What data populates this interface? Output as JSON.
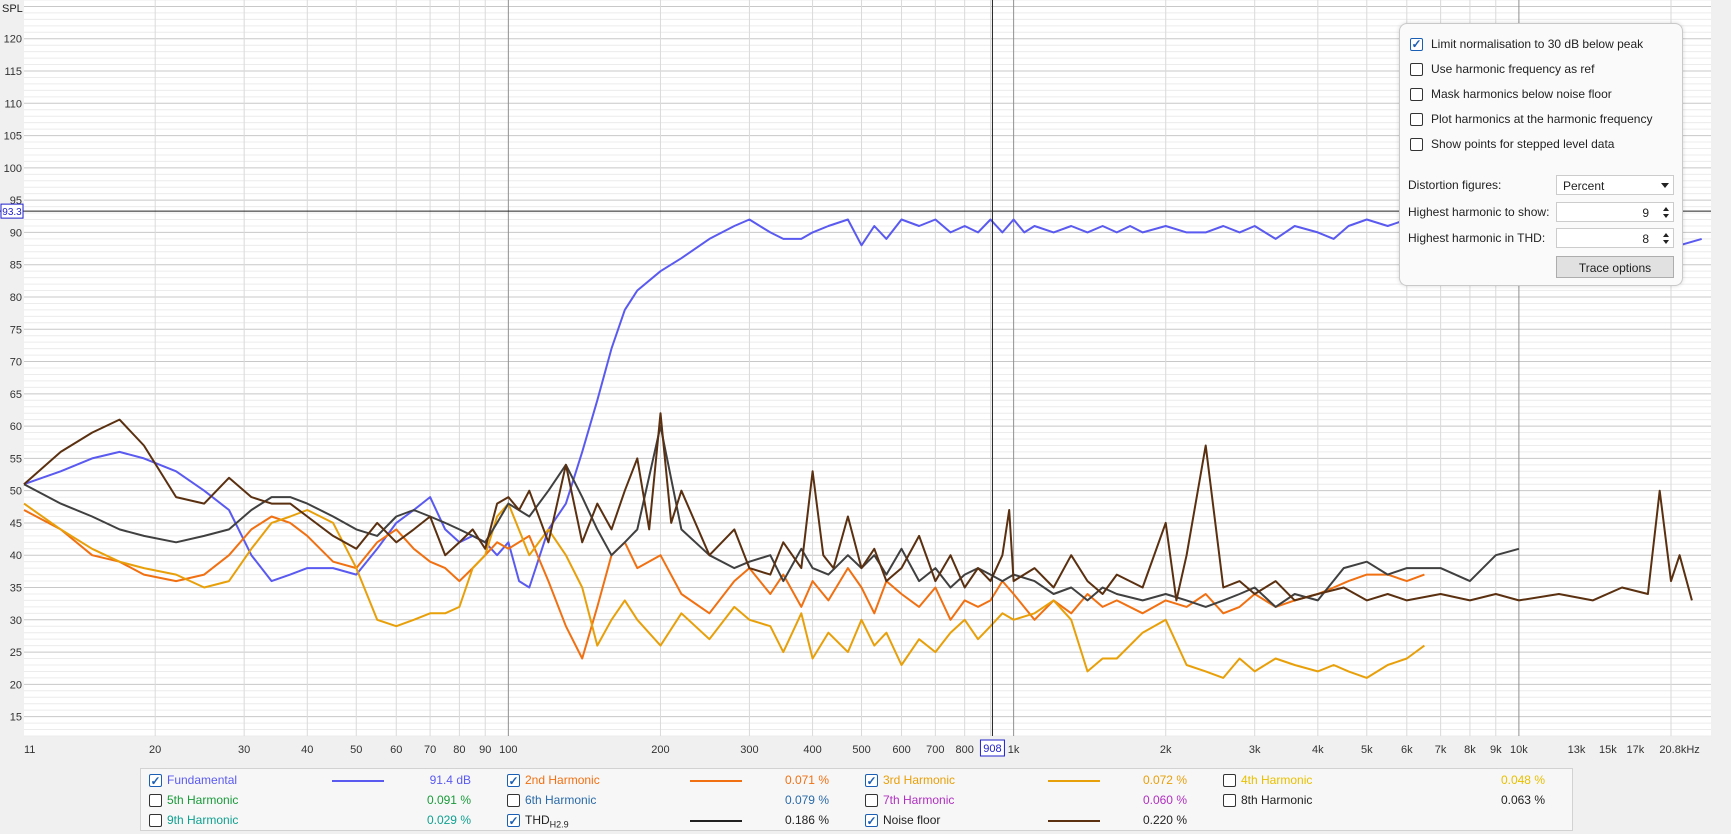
{
  "chart_data": {
    "type": "line",
    "ylabel": "SPL",
    "x_scale": "log",
    "xlim": [
      11,
      24000
    ],
    "ylim": [
      12,
      126
    ],
    "y_ticks": [
      15,
      20,
      25,
      30,
      35,
      40,
      45,
      50,
      55,
      60,
      65,
      70,
      75,
      80,
      85,
      90,
      95,
      100,
      105,
      110,
      115,
      120
    ],
    "x_ticks": [
      {
        "v": 11,
        "t": "11"
      },
      {
        "v": 20,
        "t": "20"
      },
      {
        "v": 30,
        "t": "30"
      },
      {
        "v": 40,
        "t": "40"
      },
      {
        "v": 50,
        "t": "50"
      },
      {
        "v": 60,
        "t": "60"
      },
      {
        "v": 70,
        "t": "70"
      },
      {
        "v": 80,
        "t": "80"
      },
      {
        "v": 90,
        "t": "90"
      },
      {
        "v": 100,
        "t": "100"
      },
      {
        "v": 200,
        "t": "200"
      },
      {
        "v": 300,
        "t": "300"
      },
      {
        "v": 400,
        "t": "400"
      },
      {
        "v": 500,
        "t": "500"
      },
      {
        "v": 600,
        "t": "600"
      },
      {
        "v": 700,
        "t": "700"
      },
      {
        "v": 800,
        "t": "800"
      },
      {
        "v": 1000,
        "t": "1k"
      },
      {
        "v": 2000,
        "t": "2k"
      },
      {
        "v": 3000,
        "t": "3k"
      },
      {
        "v": 4000,
        "t": "4k"
      },
      {
        "v": 5000,
        "t": "5k"
      },
      {
        "v": 6000,
        "t": "6k"
      },
      {
        "v": 7000,
        "t": "7k"
      },
      {
        "v": 8000,
        "t": "8k"
      },
      {
        "v": 9000,
        "t": "9k"
      },
      {
        "v": 10000,
        "t": "10k"
      },
      {
        "v": 13000,
        "t": "13k"
      },
      {
        "v": 15000,
        "t": "15k"
      },
      {
        "v": 17000,
        "t": "17k"
      },
      {
        "v": 20800,
        "t": "20.8kHz"
      }
    ],
    "cursor": {
      "x": 908,
      "x_label": "908",
      "y": 93.3,
      "y_label": "93.3"
    },
    "series": [
      {
        "name": "Fundamental",
        "color": "#5a5af0",
        "x": [
          11,
          13,
          15,
          17,
          19,
          22,
          25,
          28,
          31,
          34,
          37,
          40,
          45,
          50,
          55,
          60,
          65,
          70,
          75,
          80,
          85,
          90,
          95,
          100,
          105,
          110,
          120,
          130,
          140,
          150,
          160,
          170,
          180,
          200,
          220,
          250,
          280,
          300,
          330,
          350,
          380,
          400,
          430,
          470,
          500,
          530,
          560,
          600,
          650,
          700,
          750,
          800,
          850,
          900,
          950,
          1000,
          1050,
          1100,
          1200,
          1300,
          1400,
          1500,
          1600,
          1700,
          1800,
          2000,
          2200,
          2400,
          2600,
          2800,
          3000,
          3300,
          3600,
          4000,
          4300,
          4600,
          5000,
          5500,
          6000,
          7000,
          8000,
          9000,
          10000,
          11000,
          13000,
          15000,
          17000,
          19000,
          20800,
          23000
        ],
        "y": [
          51,
          53,
          55,
          56,
          55,
          53,
          50,
          47,
          40,
          36,
          37,
          38,
          38,
          37,
          41,
          45,
          47,
          49,
          44,
          42,
          43,
          42,
          40,
          42,
          36,
          35,
          44,
          48,
          56,
          64,
          72,
          78,
          81,
          84,
          86,
          89,
          91,
          92,
          90,
          89,
          89,
          90,
          91,
          92,
          88,
          91,
          89,
          92,
          91,
          92,
          90,
          91,
          90,
          92,
          90,
          92,
          90,
          91,
          90,
          91,
          90,
          91,
          90,
          91,
          90,
          91,
          90,
          90,
          91,
          90,
          91,
          89,
          91,
          90,
          89,
          91,
          92,
          91,
          92,
          90,
          92,
          90,
          91,
          90,
          91,
          88,
          89,
          88,
          88,
          89
        ]
      },
      {
        "name": "2nd Harmonic",
        "color": "#f07012",
        "x": [
          11,
          13,
          15,
          17,
          19,
          22,
          25,
          28,
          31,
          34,
          37,
          40,
          45,
          50,
          55,
          60,
          65,
          70,
          75,
          80,
          85,
          90,
          95,
          100,
          110,
          120,
          130,
          140,
          150,
          160,
          170,
          180,
          200,
          220,
          250,
          280,
          300,
          330,
          350,
          380,
          400,
          430,
          470,
          500,
          530,
          560,
          600,
          650,
          700,
          750,
          800,
          850,
          900,
          950,
          1000,
          1100,
          1200,
          1300,
          1400,
          1500,
          1600,
          1800,
          2000,
          2200,
          2400,
          2600,
          2800,
          3000,
          3300,
          3600,
          4000,
          4300,
          4600,
          5000,
          5500,
          6000,
          6500
        ],
        "y": [
          47,
          44,
          40,
          39,
          37,
          36,
          37,
          40,
          44,
          46,
          45,
          43,
          39,
          38,
          42,
          44,
          41,
          39,
          38,
          36,
          38,
          40,
          42,
          41,
          43,
          36,
          29,
          24,
          32,
          40,
          42,
          38,
          40,
          34,
          31,
          36,
          38,
          34,
          37,
          32,
          36,
          33,
          38,
          35,
          31,
          36,
          34,
          32,
          35,
          30,
          33,
          32,
          33,
          36,
          34,
          30,
          33,
          31,
          34,
          32,
          33,
          31,
          33,
          32,
          34,
          31,
          32,
          34,
          32,
          33,
          34,
          35,
          36,
          37,
          37,
          36,
          37
        ]
      },
      {
        "name": "3rd Harmonic",
        "color": "#e8a00a",
        "x": [
          11,
          13,
          15,
          17,
          19,
          22,
          25,
          28,
          31,
          34,
          37,
          40,
          45,
          50,
          55,
          60,
          65,
          70,
          75,
          80,
          85,
          90,
          95,
          100,
          110,
          120,
          130,
          140,
          150,
          160,
          170,
          180,
          200,
          220,
          250,
          280,
          300,
          330,
          350,
          380,
          400,
          430,
          470,
          500,
          530,
          560,
          600,
          650,
          700,
          750,
          800,
          850,
          900,
          950,
          1000,
          1100,
          1200,
          1300,
          1400,
          1500,
          1600,
          1800,
          2000,
          2200,
          2400,
          2600,
          2800,
          3000,
          3300,
          3600,
          4000,
          4300,
          4600,
          5000,
          5500,
          6000,
          6500
        ],
        "y": [
          48,
          44,
          41,
          39,
          38,
          37,
          35,
          36,
          41,
          45,
          46,
          47,
          45,
          38,
          30,
          29,
          30,
          31,
          31,
          32,
          38,
          40,
          46,
          48,
          40,
          44,
          40,
          35,
          26,
          30,
          33,
          30,
          26,
          31,
          27,
          32,
          30,
          29,
          25,
          31,
          24,
          28,
          25,
          30,
          26,
          28,
          23,
          27,
          25,
          28,
          30,
          27,
          29,
          31,
          30,
          31,
          33,
          30,
          22,
          24,
          24,
          28,
          30,
          23,
          22,
          21,
          24,
          22,
          24,
          23,
          22,
          23,
          22,
          21,
          23,
          24,
          26
        ]
      },
      {
        "name": "THD",
        "color": "#404040",
        "x": [
          11,
          13,
          15,
          17,
          19,
          22,
          25,
          28,
          31,
          34,
          37,
          40,
          45,
          50,
          55,
          60,
          65,
          70,
          75,
          80,
          85,
          90,
          95,
          100,
          110,
          120,
          130,
          140,
          150,
          160,
          170,
          180,
          200,
          220,
          250,
          280,
          300,
          330,
          350,
          380,
          400,
          430,
          470,
          500,
          530,
          560,
          600,
          650,
          700,
          750,
          800,
          850,
          900,
          950,
          1000,
          1100,
          1200,
          1300,
          1400,
          1500,
          1600,
          1800,
          2000,
          2200,
          2400,
          2600,
          2800,
          3000,
          3300,
          3600,
          4000,
          4500,
          5000,
          5500,
          6000,
          7000,
          8000,
          9000,
          10000
        ],
        "y": [
          51,
          48,
          46,
          44,
          43,
          42,
          43,
          44,
          47,
          49,
          49,
          48,
          46,
          44,
          43,
          46,
          47,
          46,
          45,
          44,
          43,
          42,
          45,
          48,
          46,
          50,
          54,
          49,
          44,
          40,
          42,
          44,
          60,
          44,
          40,
          38,
          39,
          40,
          36,
          41,
          38,
          37,
          40,
          38,
          40,
          37,
          41,
          36,
          38,
          35,
          37,
          38,
          37,
          36,
          37,
          36,
          34,
          35,
          33,
          35,
          34,
          33,
          34,
          33,
          32,
          33,
          34,
          35,
          32,
          34,
          33,
          38,
          39,
          37,
          38,
          38,
          36,
          40,
          41
        ]
      },
      {
        "name": "Noise floor",
        "color": "#5a3010",
        "x": [
          11,
          13,
          15,
          17,
          19,
          22,
          25,
          28,
          31,
          34,
          37,
          40,
          45,
          50,
          55,
          60,
          65,
          70,
          75,
          80,
          85,
          90,
          95,
          100,
          105,
          110,
          120,
          130,
          140,
          150,
          160,
          170,
          180,
          190,
          200,
          210,
          220,
          250,
          280,
          300,
          330,
          350,
          380,
          400,
          420,
          440,
          470,
          500,
          530,
          560,
          600,
          650,
          700,
          750,
          800,
          850,
          900,
          950,
          980,
          1000,
          1100,
          1200,
          1300,
          1400,
          1500,
          1600,
          1800,
          2000,
          2100,
          2200,
          2400,
          2600,
          2800,
          3000,
          3300,
          3600,
          4000,
          4500,
          5000,
          5500,
          6000,
          7000,
          8000,
          9000,
          10000,
          12000,
          14000,
          16000,
          18000,
          19000,
          20000,
          20800,
          22000
        ],
        "y": [
          51,
          56,
          59,
          61,
          57,
          49,
          48,
          52,
          49,
          48,
          48,
          46,
          43,
          41,
          45,
          42,
          44,
          46,
          40,
          42,
          44,
          41,
          48,
          49,
          47,
          50,
          42,
          54,
          42,
          48,
          44,
          50,
          55,
          44,
          62,
          45,
          50,
          40,
          44,
          38,
          37,
          42,
          38,
          53,
          40,
          38,
          46,
          38,
          41,
          36,
          38,
          43,
          36,
          40,
          35,
          38,
          36,
          40,
          47,
          36,
          38,
          35,
          40,
          36,
          34,
          37,
          35,
          45,
          33,
          40,
          57,
          35,
          36,
          34,
          36,
          33,
          34,
          35,
          33,
          34,
          33,
          34,
          33,
          34,
          33,
          34,
          33,
          35,
          34,
          50,
          36,
          40,
          33
        ]
      }
    ]
  },
  "options": {
    "limit_norm": "Limit normalisation to 30 dB below peak",
    "harm_freq_ref": "Use harmonic frequency as ref",
    "mask_harm": "Mask harmonics below noise floor",
    "plot_harm": "Plot harmonics at the harmonic frequency",
    "show_points": "Show points for stepped level data",
    "dist_label": "Distortion figures:",
    "dist_value": "Percent",
    "highest_show_label": "Highest harmonic to show:",
    "highest_show_value": "9",
    "highest_thd_label": "Highest harmonic in THD:",
    "highest_thd_value": "8",
    "trace_button": "Trace options"
  },
  "legend": [
    {
      "name": "Fundamental",
      "value": "91.4 dB",
      "color": "#5a5af0",
      "checked": true,
      "swatch": true
    },
    {
      "name": "2nd Harmonic",
      "value": "0.071 %",
      "color": "#f07012",
      "checked": true,
      "swatch": true
    },
    {
      "name": "3rd Harmonic",
      "value": "0.072 %",
      "color": "#e8a00a",
      "checked": true,
      "swatch": true
    },
    {
      "name": "4th Harmonic",
      "value": "0.048 %",
      "color": "#e8c000",
      "checked": false,
      "swatch": false
    },
    {
      "name": "5th Harmonic",
      "value": "0.091 %",
      "color": "#1a9a3a",
      "checked": false,
      "swatch": false
    },
    {
      "name": "6th Harmonic",
      "value": "0.079 %",
      "color": "#2a6aa8",
      "checked": false,
      "swatch": false
    },
    {
      "name": "7th Harmonic",
      "value": "0.060 %",
      "color": "#b030c0",
      "checked": false,
      "swatch": false
    },
    {
      "name": "8th Harmonic",
      "value": "0.063 %",
      "color": "#505050",
      "checked": false,
      "swatch": false
    },
    {
      "name": "9th Harmonic",
      "value": "0.029 %",
      "color": "#10a090",
      "checked": false,
      "swatch": false
    },
    {
      "name": "THD",
      "sub": "H2.9",
      "value": "0.186 %",
      "color": "#202020",
      "checked": true,
      "swatch": true
    },
    {
      "name": "Noise floor",
      "value": "0.220 %",
      "color": "#5a3010",
      "checked": true,
      "swatch": true
    }
  ]
}
